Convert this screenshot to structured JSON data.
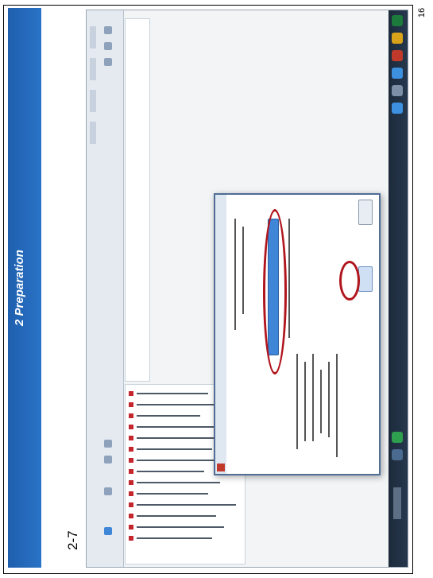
{
  "slide": {
    "title": "2 Preparation",
    "step": "2-7",
    "page_number": "16"
  },
  "screenshot": {
    "description_visible": false,
    "highlights": [
      "progress-bar-highlight",
      "ok-button-highlight"
    ],
    "colors": {
      "title_bar": "#1f5fae",
      "highlight": "#b0141c",
      "progress": "#3f86d8",
      "taskbar": "#1c2a3b"
    }
  }
}
